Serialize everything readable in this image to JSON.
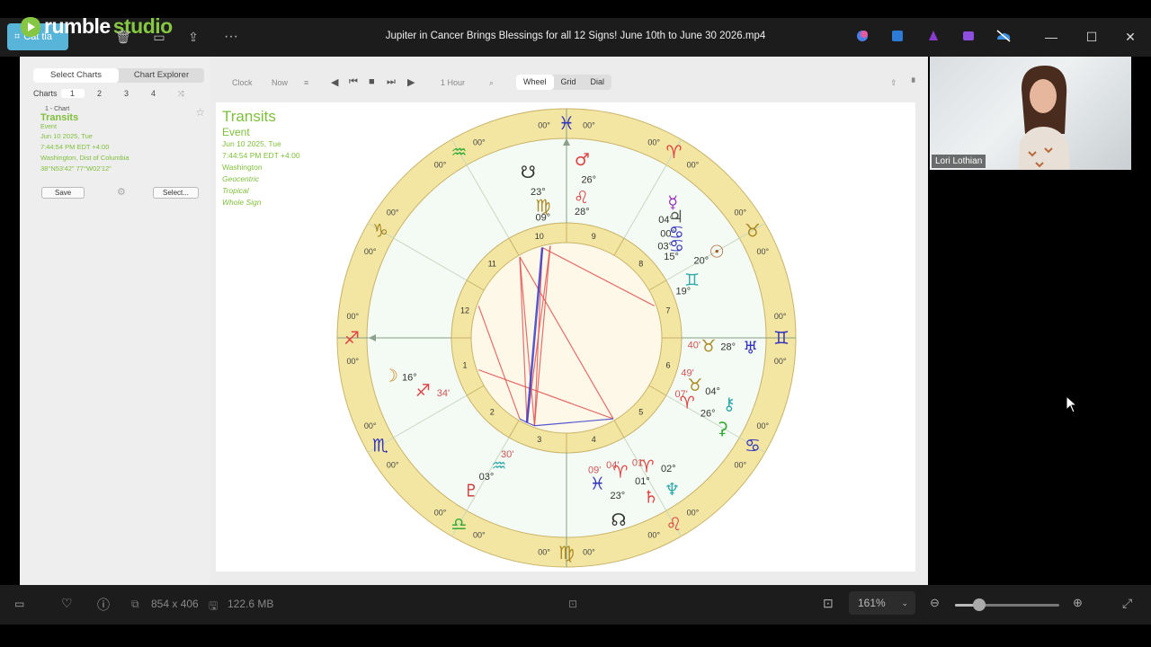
{
  "topbar": {
    "crop_label": "Cắt tỉa",
    "logo_word1": "rumble",
    "logo_word2": "studio",
    "more_label": "···",
    "window_title": "Jupiter in Cancer Brings Blessings for all 12 Signs! June 10th to June 30 2026.mp4",
    "minimize": "—",
    "maximize": "☐",
    "close": "✕"
  },
  "sidebar": {
    "tab_select": "Select Charts",
    "tab_explorer": "Chart Explorer",
    "charts_label": "Charts",
    "chart_numbers": [
      "1",
      "2",
      "3",
      "4"
    ],
    "card": {
      "index": "1 - Chart",
      "title": "Transits",
      "type": "Event",
      "date": "Jun 10 2025, Tue",
      "time": "7:44:54 PM EDT +4:00",
      "place": "Washington, Dist of Columbia",
      "coords": "38°N53'42\" 77°W02'12\"",
      "save": "Save",
      "select": "Select..."
    }
  },
  "toolbar": {
    "clock": "Clock",
    "now": "Now",
    "step": "1 Hour",
    "tabs": [
      "Wheel",
      "Grid",
      "Dial"
    ]
  },
  "chart_header": {
    "title": "Transits",
    "type": "Event",
    "date": "Jun 10 2025, Tue",
    "time": "7:44:54 PM EDT +4:00",
    "place": "Washington",
    "geo": "Geocentric",
    "zodiac": "Tropical",
    "houses": "Whole Sign"
  },
  "wheel": {
    "zero": "00°",
    "houses": [
      "1",
      "2",
      "3",
      "4",
      "5",
      "6",
      "7",
      "8",
      "9",
      "10",
      "11",
      "12"
    ],
    "colors": {
      "ring": "#f3e6a3",
      "ring_edge": "#c9b36a",
      "inner": "#fdf8e8",
      "aspect_red": "#e05555",
      "aspect_blue": "#3a3acb"
    },
    "planet_degrees": {
      "mars": "26°",
      "mars_min": "28°",
      "node": "23°",
      "node_min": "09°",
      "mercury": "04°",
      "jupiter": "00°",
      "venus_min": "03°",
      "min15": "15°",
      "sun": "20°",
      "sun_min": "19°",
      "uranus": "28°",
      "uranus_min": "40'",
      "chiron": "04°",
      "chiron_min": "49'",
      "ceres": "26°",
      "ceres_min": "07'",
      "neptune": "02°",
      "neptune_min": "01'",
      "saturn": "01°",
      "saturn_min": "04'",
      "south_node": "23°",
      "south_node_min": "09'",
      "pluto": "03°",
      "pluto_min": "30'",
      "moon": "16°",
      "moon_min": "34'"
    }
  },
  "webcam": {
    "name": "Lori Lothian"
  },
  "bottombar": {
    "dimensions": "854 x 406",
    "size": "122.6 MB",
    "zoom": "161%",
    "zoom_level": 0.23
  }
}
